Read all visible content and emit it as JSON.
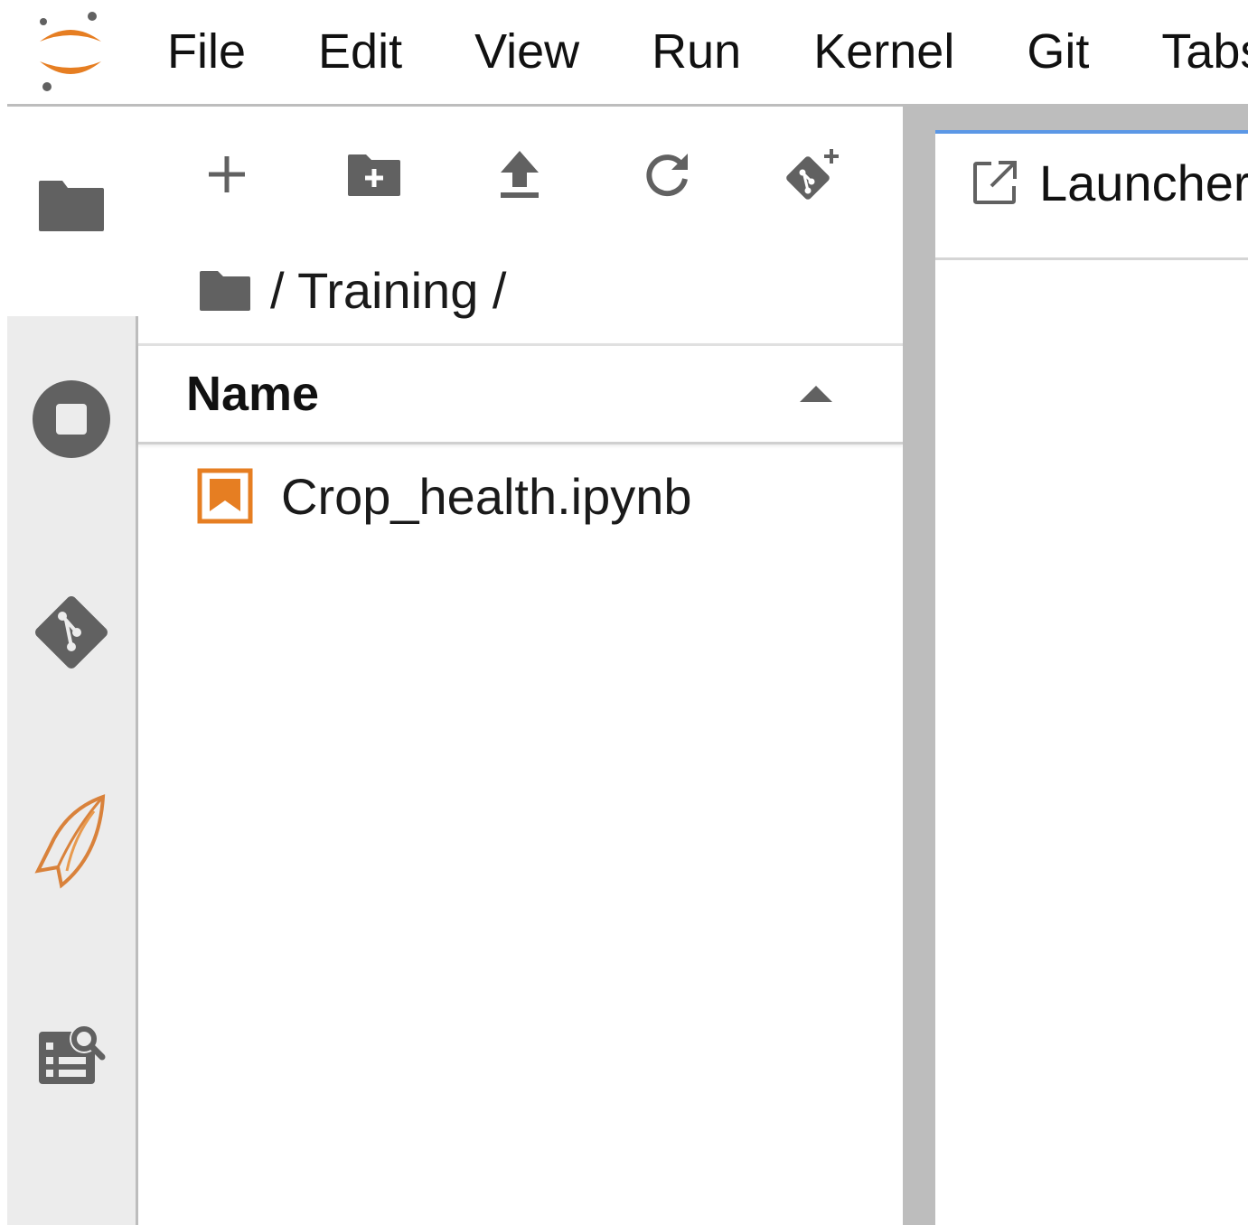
{
  "menu": {
    "items": [
      {
        "label": "File"
      },
      {
        "label": "Edit"
      },
      {
        "label": "View"
      },
      {
        "label": "Run"
      },
      {
        "label": "Kernel"
      },
      {
        "label": "Git"
      },
      {
        "label": "Tabs"
      }
    ]
  },
  "sidebar": {
    "items": [
      {
        "icon": "folder-icon",
        "active": true
      },
      {
        "icon": "running-stop-icon",
        "active": false
      },
      {
        "icon": "git-icon",
        "active": false
      },
      {
        "icon": "feather-extension-icon",
        "active": false
      },
      {
        "icon": "property-inspector-icon",
        "active": false
      }
    ]
  },
  "file_browser": {
    "toolbar": [
      "new-launcher-icon",
      "new-folder-icon",
      "upload-icon",
      "refresh-icon",
      "git-clone-icon"
    ],
    "breadcrumb": "/ Training /",
    "column_header": "Name",
    "sort": "ascending",
    "files": [
      {
        "name": "Crop_health.ipynb",
        "type": "notebook"
      }
    ]
  },
  "tabs": [
    {
      "label": "Launcher",
      "icon": "launcher-icon",
      "active": true
    }
  ],
  "colors": {
    "accent": "#5b97e6",
    "jupyter_orange": "#e67e22",
    "sidebar_bg": "#ececec",
    "border": "#bdbdbd"
  }
}
